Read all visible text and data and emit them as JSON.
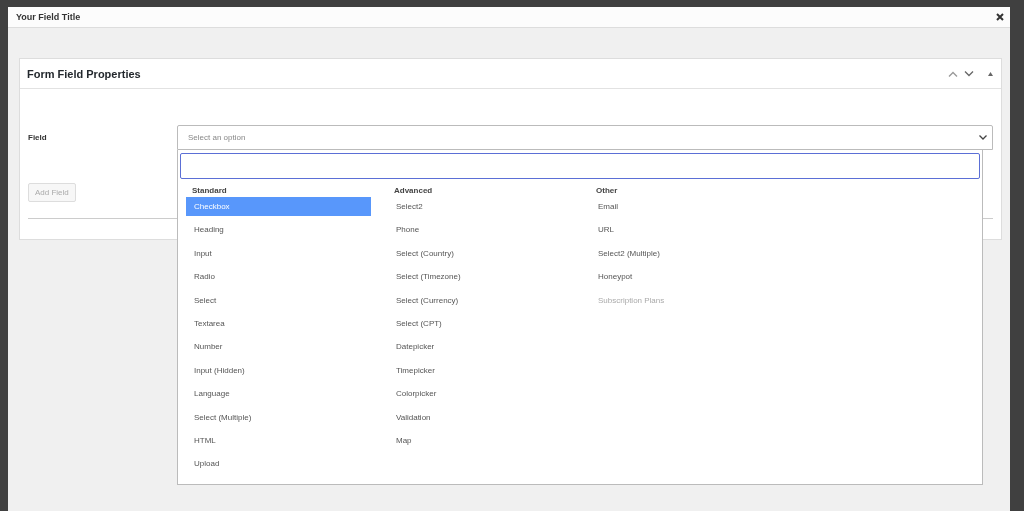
{
  "window": {
    "title": "Your Field Title"
  },
  "panel": {
    "title": "Form Field Properties"
  },
  "field": {
    "label": "Field",
    "placeholder": "Select an option",
    "expanded": true
  },
  "groups": [
    {
      "label": "Standard",
      "options": [
        {
          "label": "Checkbox",
          "selected": true,
          "disabled": false
        },
        {
          "label": "Heading",
          "selected": false,
          "disabled": false
        },
        {
          "label": "Input",
          "selected": false,
          "disabled": false
        },
        {
          "label": "Radio",
          "selected": false,
          "disabled": false
        },
        {
          "label": "Select",
          "selected": false,
          "disabled": false
        },
        {
          "label": "Textarea",
          "selected": false,
          "disabled": false
        },
        {
          "label": "Number",
          "selected": false,
          "disabled": false
        },
        {
          "label": "Input (Hidden)",
          "selected": false,
          "disabled": false
        },
        {
          "label": "Language",
          "selected": false,
          "disabled": false
        },
        {
          "label": "Select (Multiple)",
          "selected": false,
          "disabled": false
        },
        {
          "label": "HTML",
          "selected": false,
          "disabled": false
        },
        {
          "label": "Upload",
          "selected": false,
          "disabled": false
        }
      ]
    },
    {
      "label": "Advanced",
      "options": [
        {
          "label": "Select2",
          "selected": false,
          "disabled": false
        },
        {
          "label": "Phone",
          "selected": false,
          "disabled": false
        },
        {
          "label": "Select (Country)",
          "selected": false,
          "disabled": false
        },
        {
          "label": "Select (Timezone)",
          "selected": false,
          "disabled": false
        },
        {
          "label": "Select (Currency)",
          "selected": false,
          "disabled": false
        },
        {
          "label": "Select (CPT)",
          "selected": false,
          "disabled": false
        },
        {
          "label": "Datepicker",
          "selected": false,
          "disabled": false
        },
        {
          "label": "Timepicker",
          "selected": false,
          "disabled": false
        },
        {
          "label": "Colorpicker",
          "selected": false,
          "disabled": false
        },
        {
          "label": "Validation",
          "selected": false,
          "disabled": false
        },
        {
          "label": "Map",
          "selected": false,
          "disabled": false
        }
      ]
    },
    {
      "label": "Other",
      "options": [
        {
          "label": "Email",
          "selected": false,
          "disabled": false
        },
        {
          "label": "URL",
          "selected": false,
          "disabled": false
        },
        {
          "label": "Select2 (Multiple)",
          "selected": false,
          "disabled": false
        },
        {
          "label": "Honeypot",
          "selected": false,
          "disabled": false
        },
        {
          "label": "Subscription Plans",
          "selected": false,
          "disabled": true
        }
      ]
    }
  ],
  "add_button": {
    "label": "Add Field",
    "disabled": true
  }
}
